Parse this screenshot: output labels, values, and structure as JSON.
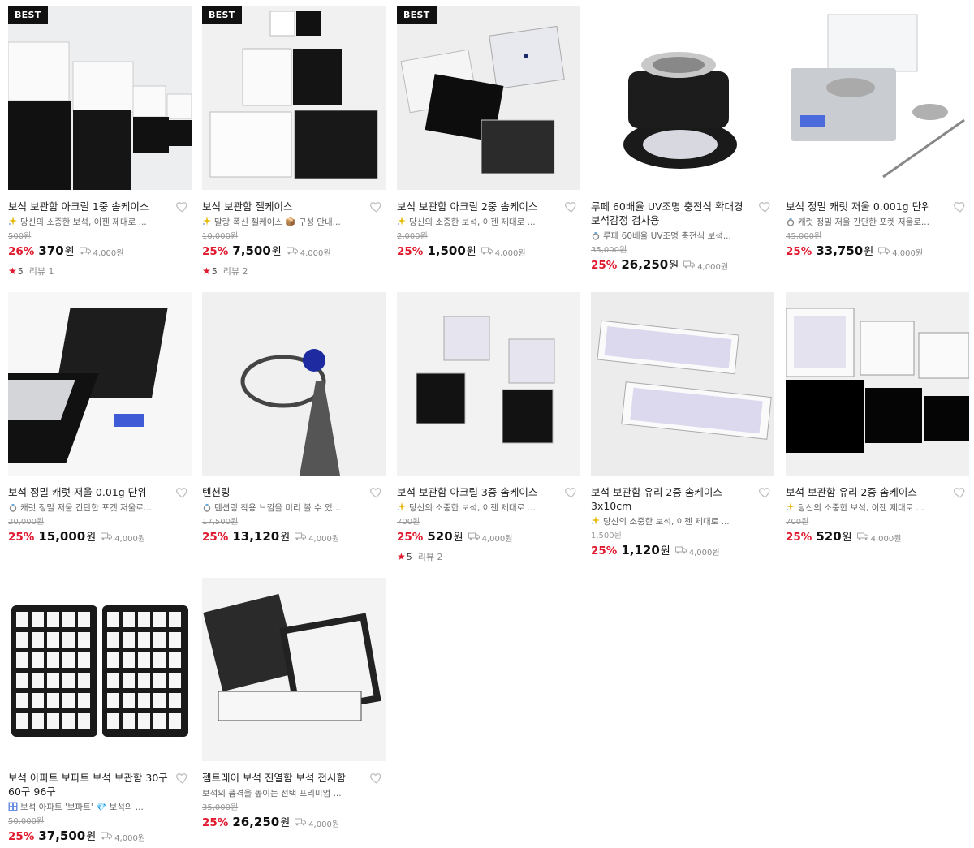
{
  "best_label": "BEST",
  "currency": "원",
  "products": [
    {
      "title": "보석 보관함 아크릴 1중 솜케이스",
      "desc_icon": "sparkle-icon",
      "desc": "당신의 소중한 보석, 이젠 제대로 ...",
      "original_price": "500원",
      "discount": "26%",
      "price": "370",
      "shipping": "4,000원",
      "rating": "5",
      "review": "리뷰 1",
      "best": true
    },
    {
      "title": "보석 보관함 젤케이스",
      "desc_icon": "sparkle-icon",
      "desc": "말랑 폭신 젤케이스 📦 구성 안내...",
      "original_price": "10,000원",
      "discount": "25%",
      "price": "7,500",
      "shipping": "4,000원",
      "rating": "5",
      "review": "리뷰 2",
      "best": true
    },
    {
      "title": "보석 보관함 아크릴 2중 솜케이스",
      "desc_icon": "sparkle-icon",
      "desc": "당신의 소중한 보석, 이젠 제대로 ...",
      "original_price": "2,000원",
      "discount": "25%",
      "price": "1,500",
      "shipping": "4,000원",
      "best": true
    },
    {
      "title": "루페 60배율 UV조명 충전식 확대경 보석감정 검사용",
      "desc_icon": "ring-icon",
      "desc": "루페 60배율 UV조명 충전식 보석...",
      "original_price": "35,000원",
      "discount": "25%",
      "price": "26,250",
      "shipping": "4,000원"
    },
    {
      "title": "보석 정밀 캐럿 저울 0.001g 단위",
      "desc_icon": "ring-icon",
      "desc": "캐럿 정밀 저울 간단한 포켓 저울로...",
      "original_price": "45,000원",
      "discount": "25%",
      "price": "33,750",
      "shipping": "4,000원"
    },
    {
      "title": "보석 정밀 캐럿 저울 0.01g 단위",
      "desc_icon": "ring-icon",
      "desc": "캐럿 정밀 저울 간단한 포켓 저울로...",
      "original_price": "20,000원",
      "discount": "25%",
      "price": "15,000",
      "shipping": "4,000원"
    },
    {
      "title": "텐션링",
      "desc_icon": "ring-icon",
      "desc": "텐션링 착용 느낌을 미리 볼 수 있...",
      "original_price": "17,500원",
      "discount": "25%",
      "price": "13,120",
      "shipping": "4,000원"
    },
    {
      "title": "보석 보관함 아크릴 3중 솜케이스",
      "desc_icon": "sparkle-icon",
      "desc": "당신의 소중한 보석, 이젠 제대로 ...",
      "original_price": "700원",
      "discount": "25%",
      "price": "520",
      "shipping": "4,000원",
      "rating": "5",
      "review": "리뷰 2"
    },
    {
      "title": "보석 보관함 유리 2중 솜케이스 3x10cm",
      "desc_icon": "sparkle-icon",
      "desc": "당신의 소중한 보석, 이젠 제대로 ...",
      "original_price": "1,500원",
      "discount": "25%",
      "price": "1,120",
      "shipping": "4,000원"
    },
    {
      "title": "보석 보관함 유리 2중 솜케이스",
      "desc_icon": "sparkle-icon",
      "desc": "당신의 소중한 보석, 이젠 제대로 ...",
      "original_price": "700원",
      "discount": "25%",
      "price": "520",
      "shipping": "4,000원"
    },
    {
      "title": "보석 아파트 보파트 보석 보관함 30구 60구 96구",
      "desc_icon": "grid-icon",
      "desc": "보석 아파트 '보파트' 💎 보석의 ...",
      "original_price": "50,000원",
      "discount": "25%",
      "price": "37,500",
      "shipping": "4,000원"
    },
    {
      "title": "젬트레이 보석 진열함 보석 전시함",
      "desc_icon": "",
      "desc": "보석의 품격을 높이는 선택 프리미엄 ...",
      "original_price": "35,000원",
      "discount": "25%",
      "price": "26,250",
      "shipping": "4,000원"
    }
  ]
}
